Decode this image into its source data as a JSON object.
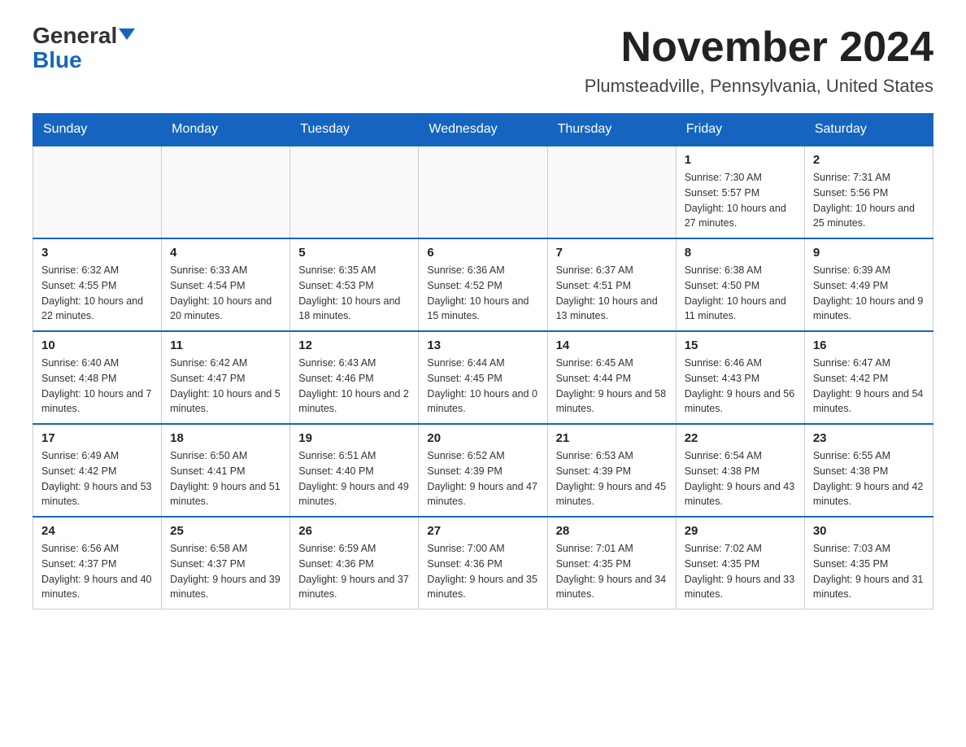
{
  "header": {
    "logo_top": "General",
    "logo_bottom": "Blue",
    "main_title": "November 2024",
    "subtitle": "Plumsteadville, Pennsylvania, United States"
  },
  "weekdays": [
    "Sunday",
    "Monday",
    "Tuesday",
    "Wednesday",
    "Thursday",
    "Friday",
    "Saturday"
  ],
  "weeks": [
    [
      {
        "day": "",
        "info": ""
      },
      {
        "day": "",
        "info": ""
      },
      {
        "day": "",
        "info": ""
      },
      {
        "day": "",
        "info": ""
      },
      {
        "day": "",
        "info": ""
      },
      {
        "day": "1",
        "info": "Sunrise: 7:30 AM\nSunset: 5:57 PM\nDaylight: 10 hours and 27 minutes."
      },
      {
        "day": "2",
        "info": "Sunrise: 7:31 AM\nSunset: 5:56 PM\nDaylight: 10 hours and 25 minutes."
      }
    ],
    [
      {
        "day": "3",
        "info": "Sunrise: 6:32 AM\nSunset: 4:55 PM\nDaylight: 10 hours and 22 minutes."
      },
      {
        "day": "4",
        "info": "Sunrise: 6:33 AM\nSunset: 4:54 PM\nDaylight: 10 hours and 20 minutes."
      },
      {
        "day": "5",
        "info": "Sunrise: 6:35 AM\nSunset: 4:53 PM\nDaylight: 10 hours and 18 minutes."
      },
      {
        "day": "6",
        "info": "Sunrise: 6:36 AM\nSunset: 4:52 PM\nDaylight: 10 hours and 15 minutes."
      },
      {
        "day": "7",
        "info": "Sunrise: 6:37 AM\nSunset: 4:51 PM\nDaylight: 10 hours and 13 minutes."
      },
      {
        "day": "8",
        "info": "Sunrise: 6:38 AM\nSunset: 4:50 PM\nDaylight: 10 hours and 11 minutes."
      },
      {
        "day": "9",
        "info": "Sunrise: 6:39 AM\nSunset: 4:49 PM\nDaylight: 10 hours and 9 minutes."
      }
    ],
    [
      {
        "day": "10",
        "info": "Sunrise: 6:40 AM\nSunset: 4:48 PM\nDaylight: 10 hours and 7 minutes."
      },
      {
        "day": "11",
        "info": "Sunrise: 6:42 AM\nSunset: 4:47 PM\nDaylight: 10 hours and 5 minutes."
      },
      {
        "day": "12",
        "info": "Sunrise: 6:43 AM\nSunset: 4:46 PM\nDaylight: 10 hours and 2 minutes."
      },
      {
        "day": "13",
        "info": "Sunrise: 6:44 AM\nSunset: 4:45 PM\nDaylight: 10 hours and 0 minutes."
      },
      {
        "day": "14",
        "info": "Sunrise: 6:45 AM\nSunset: 4:44 PM\nDaylight: 9 hours and 58 minutes."
      },
      {
        "day": "15",
        "info": "Sunrise: 6:46 AM\nSunset: 4:43 PM\nDaylight: 9 hours and 56 minutes."
      },
      {
        "day": "16",
        "info": "Sunrise: 6:47 AM\nSunset: 4:42 PM\nDaylight: 9 hours and 54 minutes."
      }
    ],
    [
      {
        "day": "17",
        "info": "Sunrise: 6:49 AM\nSunset: 4:42 PM\nDaylight: 9 hours and 53 minutes."
      },
      {
        "day": "18",
        "info": "Sunrise: 6:50 AM\nSunset: 4:41 PM\nDaylight: 9 hours and 51 minutes."
      },
      {
        "day": "19",
        "info": "Sunrise: 6:51 AM\nSunset: 4:40 PM\nDaylight: 9 hours and 49 minutes."
      },
      {
        "day": "20",
        "info": "Sunrise: 6:52 AM\nSunset: 4:39 PM\nDaylight: 9 hours and 47 minutes."
      },
      {
        "day": "21",
        "info": "Sunrise: 6:53 AM\nSunset: 4:39 PM\nDaylight: 9 hours and 45 minutes."
      },
      {
        "day": "22",
        "info": "Sunrise: 6:54 AM\nSunset: 4:38 PM\nDaylight: 9 hours and 43 minutes."
      },
      {
        "day": "23",
        "info": "Sunrise: 6:55 AM\nSunset: 4:38 PM\nDaylight: 9 hours and 42 minutes."
      }
    ],
    [
      {
        "day": "24",
        "info": "Sunrise: 6:56 AM\nSunset: 4:37 PM\nDaylight: 9 hours and 40 minutes."
      },
      {
        "day": "25",
        "info": "Sunrise: 6:58 AM\nSunset: 4:37 PM\nDaylight: 9 hours and 39 minutes."
      },
      {
        "day": "26",
        "info": "Sunrise: 6:59 AM\nSunset: 4:36 PM\nDaylight: 9 hours and 37 minutes."
      },
      {
        "day": "27",
        "info": "Sunrise: 7:00 AM\nSunset: 4:36 PM\nDaylight: 9 hours and 35 minutes."
      },
      {
        "day": "28",
        "info": "Sunrise: 7:01 AM\nSunset: 4:35 PM\nDaylight: 9 hours and 34 minutes."
      },
      {
        "day": "29",
        "info": "Sunrise: 7:02 AM\nSunset: 4:35 PM\nDaylight: 9 hours and 33 minutes."
      },
      {
        "day": "30",
        "info": "Sunrise: 7:03 AM\nSunset: 4:35 PM\nDaylight: 9 hours and 31 minutes."
      }
    ]
  ]
}
